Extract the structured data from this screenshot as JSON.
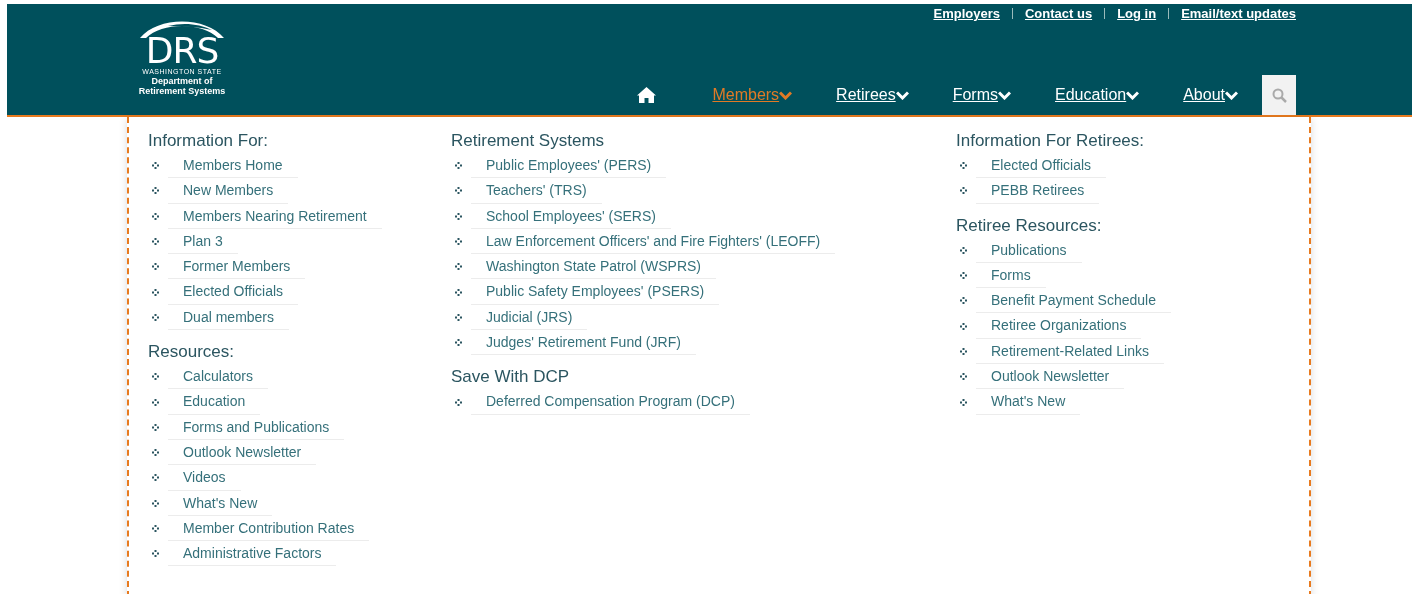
{
  "logo": {
    "mark": "DRS",
    "state": "WASHINGTON STATE",
    "name_lines": [
      "Department of",
      "Retirement Systems"
    ]
  },
  "top_links": [
    "Employers",
    "Contact us",
    "Log in",
    "Email/text updates"
  ],
  "nav": [
    {
      "label": "Members",
      "selected": true
    },
    {
      "label": "Retirees",
      "selected": false
    },
    {
      "label": "Forms",
      "selected": false
    },
    {
      "label": "Education",
      "selected": false
    },
    {
      "label": "About",
      "selected": false
    }
  ],
  "menu": {
    "columns": [
      {
        "sections": [
          {
            "heading": "Information For:",
            "items": [
              "Members Home",
              "New Members",
              "Members Nearing Retirement",
              "Plan 3",
              "Former Members",
              "Elected Officials",
              "Dual members"
            ]
          },
          {
            "heading": "Resources:",
            "items": [
              "Calculators",
              "Education",
              "Forms and Publications",
              "Outlook Newsletter",
              "Videos",
              "What's New",
              "Member Contribution Rates",
              "Administrative Factors"
            ]
          }
        ]
      },
      {
        "sections": [
          {
            "heading": "Retirement Systems",
            "items": [
              "Public Employees' (PERS)",
              "Teachers' (TRS)",
              "School Employees' (SERS)",
              "Law Enforcement Officers' and Fire Fighters' (LEOFF)",
              "Washington State Patrol (WSPRS)",
              "Public Safety Employees' (PSERS)",
              "Judicial (JRS)",
              "Judges' Retirement Fund (JRF)"
            ]
          },
          {
            "heading": "Save With DCP",
            "items": [
              "Deferred Compensation Program (DCP)"
            ]
          }
        ]
      },
      {
        "sections": [
          {
            "heading": "Information For Retirees:",
            "items": [
              "Elected Officials",
              "PEBB Retirees"
            ]
          },
          {
            "heading": "Retiree Resources:",
            "items": [
              "Publications",
              "Forms",
              "Benefit Payment Schedule",
              "Retiree Organizations",
              "Retirement-Related Links",
              "Outlook Newsletter",
              "What's New"
            ]
          }
        ]
      }
    ]
  }
}
